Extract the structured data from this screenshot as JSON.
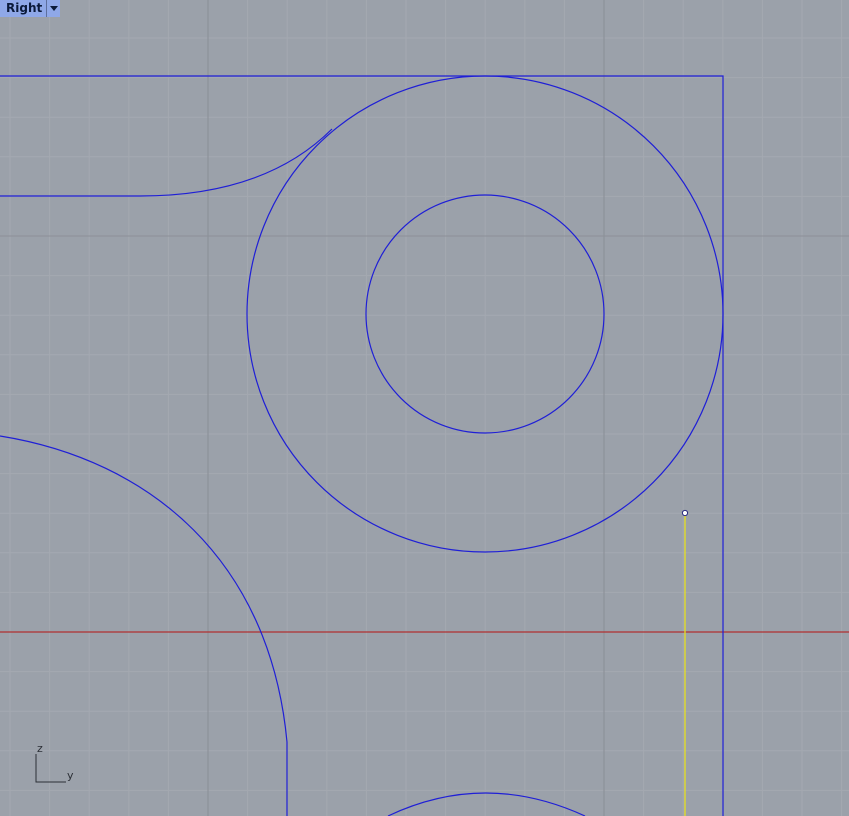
{
  "viewport": {
    "name": "Right"
  },
  "axes": {
    "vertical_label": "z",
    "horizontal_label": "y"
  },
  "colors": {
    "background": "#9ba1aa",
    "grid_minor": "#a4a9b1",
    "grid_major": "#8c9098",
    "curve": "#1f1fd6",
    "x_axis": "#b03030",
    "selected_line": "#e8e020",
    "tab_background": "#8fa8e8"
  },
  "icons": {
    "viewport_menu": "chevron-down-icon"
  }
}
